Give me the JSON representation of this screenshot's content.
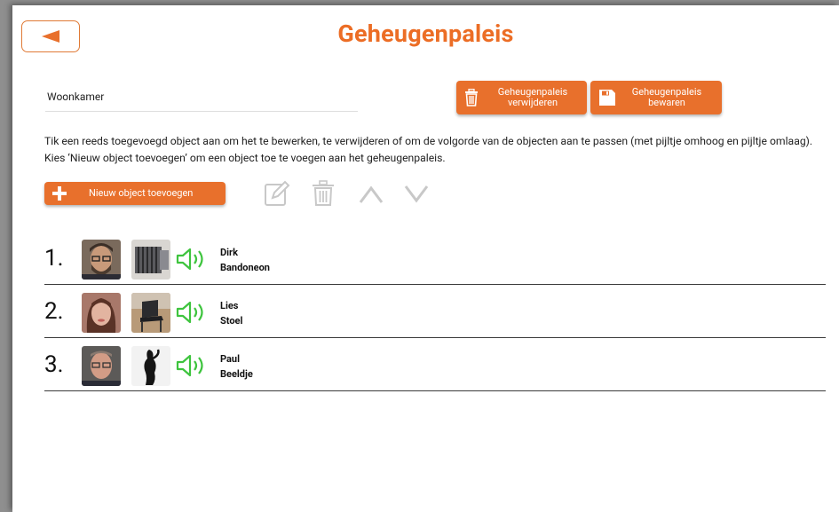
{
  "header": {
    "title": "Geheugenpaleis",
    "back_icon": "back-arrow-icon"
  },
  "palace": {
    "name": "Woonkamer"
  },
  "actions": {
    "delete_label": "Geheugenpaleis verwijderen",
    "save_label": "Geheugenpaleis bewaren"
  },
  "instructions": "Tik een reeds toegevoegd object aan om het te bewerken, te verwijderen of om de volgorde van de objecten aan te passen (met pijltje omhoog en pijltje omlaag). Kies ‘Nieuw object toevoegen’ om een object toe te voegen aan het geheugenpaleis.",
  "toolbar": {
    "add_label": "Nieuw object toevoegen",
    "tools": [
      "edit-icon",
      "trash-icon",
      "arrow-up-icon",
      "arrow-down-icon"
    ]
  },
  "objects": [
    {
      "number": "1.",
      "person": "Dirk",
      "object": "Bandoneon"
    },
    {
      "number": "2.",
      "person": "Lies",
      "object": "Stoel"
    },
    {
      "number": "3.",
      "person": "Paul",
      "object": "Beeldje"
    }
  ],
  "colors": {
    "accent": "#e8702c",
    "title": "#ec6d25",
    "speaker": "#3ec43e",
    "disabled_tool": "#c8c8c8"
  }
}
